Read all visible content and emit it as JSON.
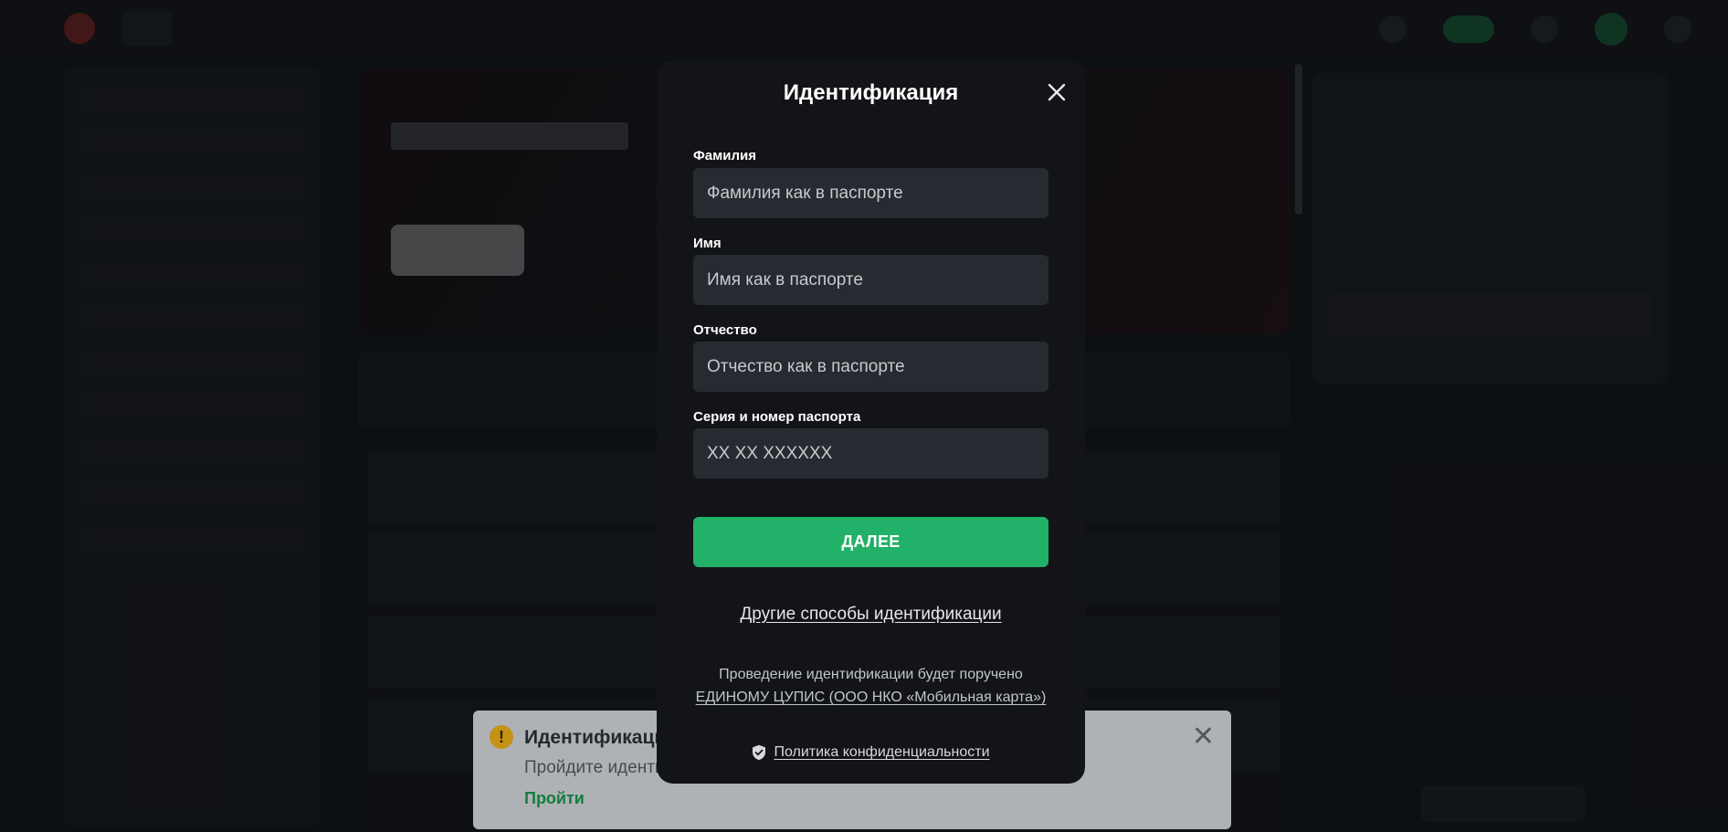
{
  "modal": {
    "title": "Идентификация",
    "fields": [
      {
        "label": "Фамилия",
        "placeholder": "Фамилия как в паспорте",
        "value": ""
      },
      {
        "label": "Имя",
        "placeholder": "Имя как в паспорте",
        "value": ""
      },
      {
        "label": "Отчество",
        "placeholder": "Отчество как в паспорте",
        "value": ""
      },
      {
        "label": "Серия и номер паспорта",
        "placeholder": "XX XX XXXXXX",
        "value": ""
      }
    ],
    "next_label": "ДАЛЕЕ",
    "other_methods_label": "Другие способы идентификации",
    "note_line1": "Проведение идентификации будет поручено",
    "note_line2": "ЕДИНОМУ ЦУПИС (ООО НКО «Мобильная карта»)",
    "privacy_label": "Политика конфиденциальности",
    "icons": {
      "close": "close-icon",
      "privacy": "shield-check-icon"
    }
  },
  "toast": {
    "title": "Идентификация",
    "text": "Пройдите иденти",
    "action": "Пройти",
    "icon": "warning-icon"
  },
  "colors": {
    "accent": "#22b168",
    "modal_bg": "#121418",
    "field_bg": "#272b31",
    "warning": "#f3b417"
  }
}
